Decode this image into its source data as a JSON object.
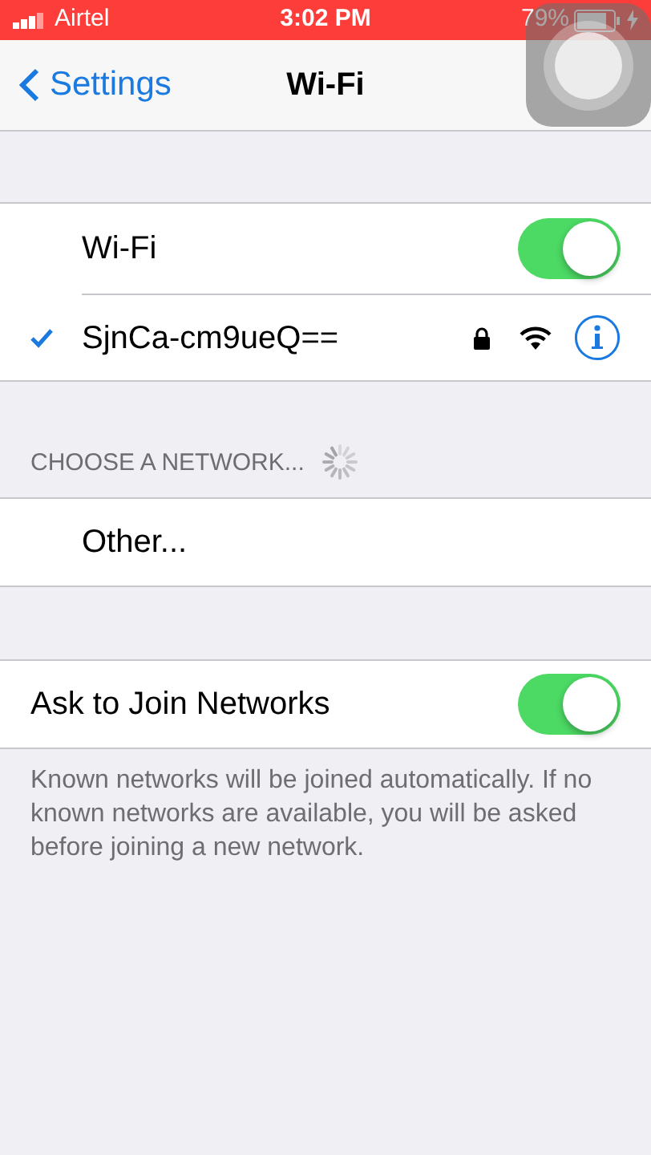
{
  "status_bar": {
    "carrier": "Airtel",
    "time": "3:02 PM",
    "battery": "79%",
    "charging": true
  },
  "nav_bar": {
    "back": "Settings",
    "title": "Wi-Fi"
  },
  "wifi": {
    "label": "Wi-Fi",
    "on": true
  },
  "connected_network": {
    "name": "SjnCa-cm9ueQ==",
    "checked": true,
    "locked": true
  },
  "networks_section": {
    "header": "CHOOSE A NETWORK...",
    "loading": true,
    "other": "Other..."
  },
  "ask_to_join": {
    "label": "Ask to Join Networks",
    "on": true
  },
  "footer": "Known networks will be joined automatically. If no known networks are available, you will be asked before joining a new network."
}
